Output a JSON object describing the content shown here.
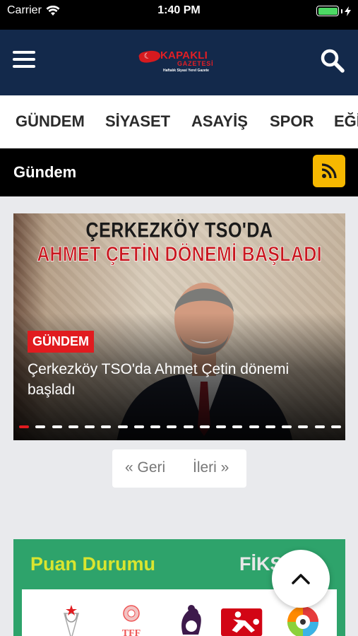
{
  "status_bar": {
    "carrier": "Carrier",
    "time": "1:40 PM"
  },
  "header": {
    "logo_lettering": [
      "KAPAKLI",
      "GAZETESİ",
      "Haftalık Siyasi Yerel Gazete"
    ]
  },
  "categories": [
    "GÜNDEM",
    "SİYASET",
    "ASAYİŞ",
    "SPOR",
    "EĞİ"
  ],
  "section": {
    "title": "Gündem"
  },
  "slider": {
    "image_headline_line1": "ÇERKEZKÖY TSO'DA",
    "image_headline_line2": "AHMET ÇETİN DÖNEMİ BAŞLADI",
    "badge": "GÜNDEM",
    "title": "Çerkezköy TSO'da Ahmet Çetin dönemi başladı",
    "dot_count": 20,
    "active_dot_index": 0
  },
  "pager": {
    "prev": "« Geri",
    "next": "İleri »"
  },
  "standings": {
    "title": "Puan Durumu",
    "fixture_title": "FİKSTÜR",
    "league_icons": [
      "super-lig-logo-icon",
      "tff-logo-icon",
      "premier-league-logo-icon",
      "bundesliga-logo-icon",
      "laliga-logo-icon"
    ]
  },
  "colors": {
    "header_bg": "#13294b",
    "accent_red": "#e11b1f",
    "rss_yellow": "#f6b800",
    "standings_green": "#2ea36b",
    "standings_title": "#d9e52f"
  }
}
